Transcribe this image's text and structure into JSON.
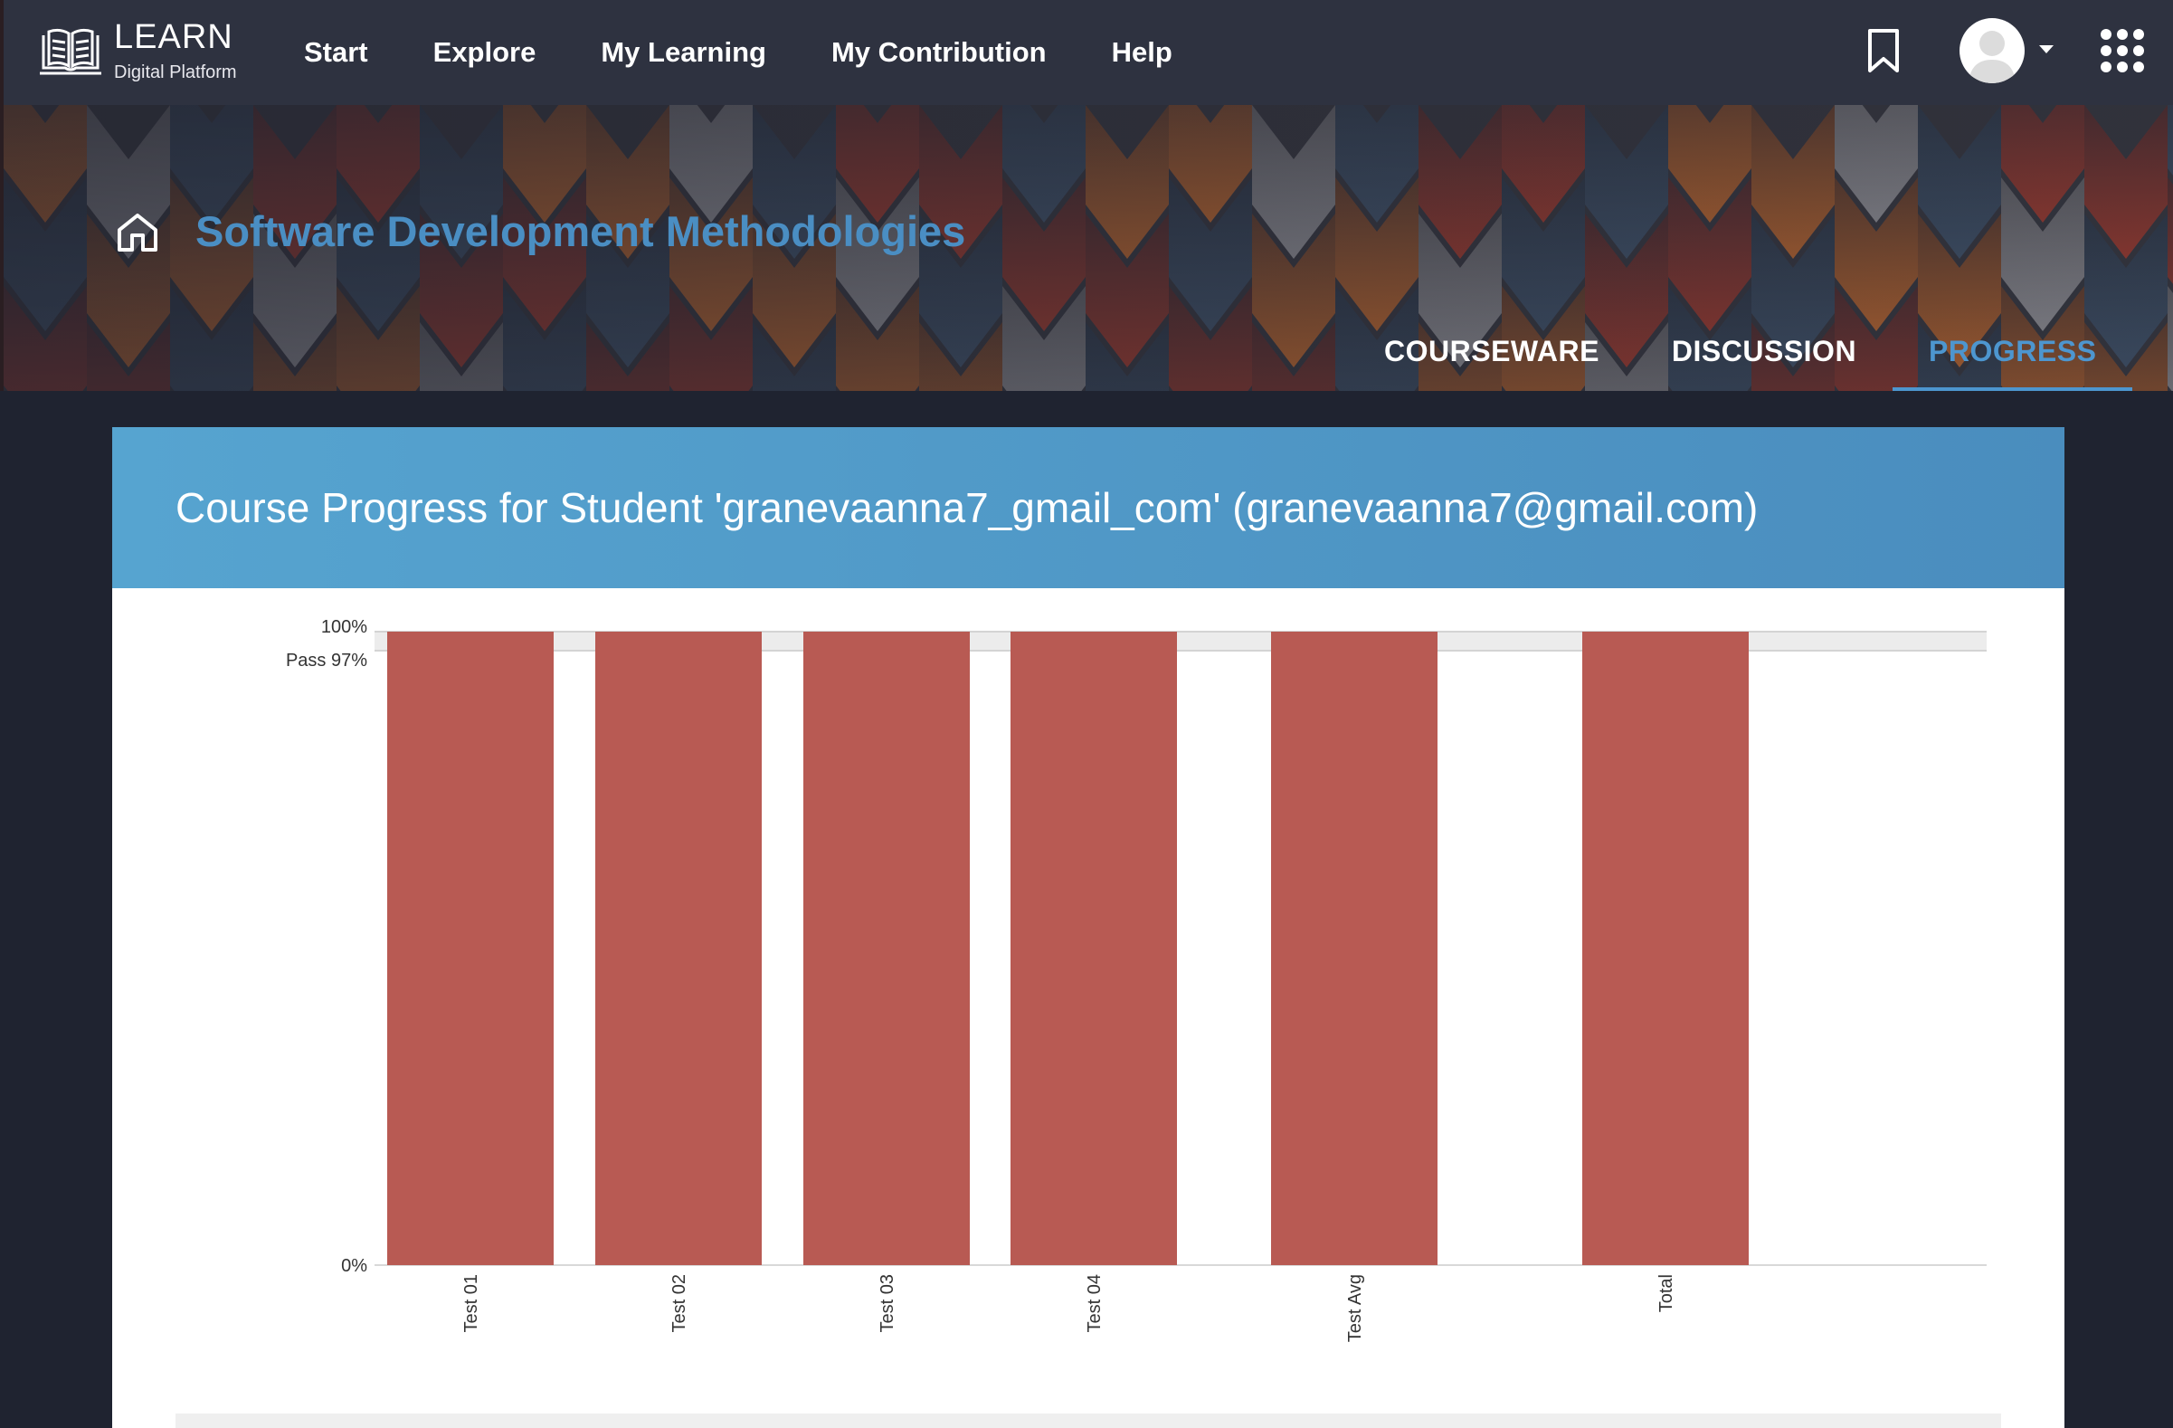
{
  "nav": {
    "logo_title": "LEARN",
    "logo_subtitle": "Digital Platform",
    "links": [
      "Start",
      "Explore",
      "My Learning",
      "My Contribution",
      "Help"
    ]
  },
  "course": {
    "title": "Software Development Methodologies",
    "tabs": [
      {
        "label": "COURSEWARE",
        "active": false
      },
      {
        "label": "DISCUSSION",
        "active": false
      },
      {
        "label": "PROGRESS",
        "active": true
      }
    ]
  },
  "progress": {
    "heading": "Course Progress for Student 'granevaanna7_gmail_com' (granevaanna7@gmail.com)"
  },
  "colors": {
    "accent": "#4d96cf",
    "bar": "#b85a53",
    "header_gradient_start": "#56a4d0",
    "header_gradient_end": "#4a8dbe"
  },
  "chart_data": {
    "type": "bar",
    "categories": [
      "Test 01",
      "Test 02",
      "Test 03",
      "Test 04",
      "Test Avg",
      "Total"
    ],
    "values": [
      100,
      100,
      100,
      100,
      100,
      100
    ],
    "ylim": [
      0,
      100
    ],
    "y_ticks": [
      {
        "value": 100,
        "label": "100%"
      },
      {
        "value": 97,
        "label": "Pass 97%"
      },
      {
        "value": 0,
        "label": "0%"
      }
    ],
    "pass_mark": 97,
    "grid": false
  }
}
